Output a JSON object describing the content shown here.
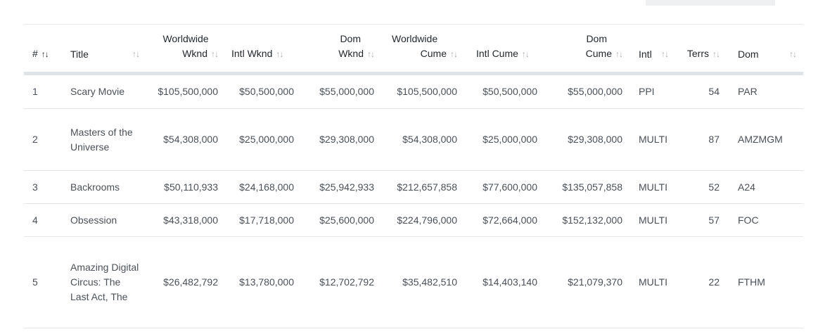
{
  "columns": {
    "rank": "#",
    "title": "Title",
    "worldwide_wknd_l1": "Worldwide",
    "worldwide_wknd_l2": "Wknd",
    "intl_wknd": "Intl Wknd",
    "dom_wknd_l1": "Dom",
    "dom_wknd_l2": "Wknd",
    "worldwide_cume_l1": "Worldwide",
    "worldwide_cume_l2": "Cume",
    "intl_cume": "Intl Cume",
    "dom_cume_l1": "Dom",
    "dom_cume_l2": "Cume",
    "intl": "Intl",
    "terrs": "Terrs",
    "dom": "Dom"
  },
  "sort_icons": {
    "active": "↑↓",
    "inactive": "↑↓"
  },
  "rows": [
    {
      "rank": "1",
      "title": "Scary Movie",
      "worldwide_wknd": "$105,500,000",
      "intl_wknd": "$50,500,000",
      "dom_wknd": "$55,000,000",
      "worldwide_cume": "$105,500,000",
      "intl_cume": "$50,500,000",
      "dom_cume": "$55,000,000",
      "intl": "PPI",
      "terrs": "54",
      "dom": "PAR"
    },
    {
      "rank": "2",
      "title": "Masters of the Universe",
      "worldwide_wknd": "$54,308,000",
      "intl_wknd": "$25,000,000",
      "dom_wknd": "$29,308,000",
      "worldwide_cume": "$54,308,000",
      "intl_cume": "$25,000,000",
      "dom_cume": "$29,308,000",
      "intl": "MULTI",
      "terrs": "87",
      "dom": "AMZMGM"
    },
    {
      "rank": "3",
      "title": "Backrooms",
      "worldwide_wknd": "$50,110,933",
      "intl_wknd": "$24,168,000",
      "dom_wknd": "$25,942,933",
      "worldwide_cume": "$212,657,858",
      "intl_cume": "$77,600,000",
      "dom_cume": "$135,057,858",
      "intl": "MULTI",
      "terrs": "52",
      "dom": "A24"
    },
    {
      "rank": "4",
      "title": "Obsession",
      "worldwide_wknd": "$43,318,000",
      "intl_wknd": "$17,718,000",
      "dom_wknd": "$25,600,000",
      "worldwide_cume": "$224,796,000",
      "intl_cume": "$72,664,000",
      "dom_cume": "$152,132,000",
      "intl": "MULTI",
      "terrs": "57",
      "dom": "FOC"
    },
    {
      "rank": "5",
      "title": "Amazing Digital Circus: The Last Act, The",
      "worldwide_wknd": "$26,482,792",
      "intl_wknd": "$13,780,000",
      "dom_wknd": "$12,702,792",
      "worldwide_cume": "$35,482,510",
      "intl_cume": "$14,403,140",
      "dom_cume": "$21,079,370",
      "intl": "MULTI",
      "terrs": "22",
      "dom": "FTHM"
    }
  ]
}
